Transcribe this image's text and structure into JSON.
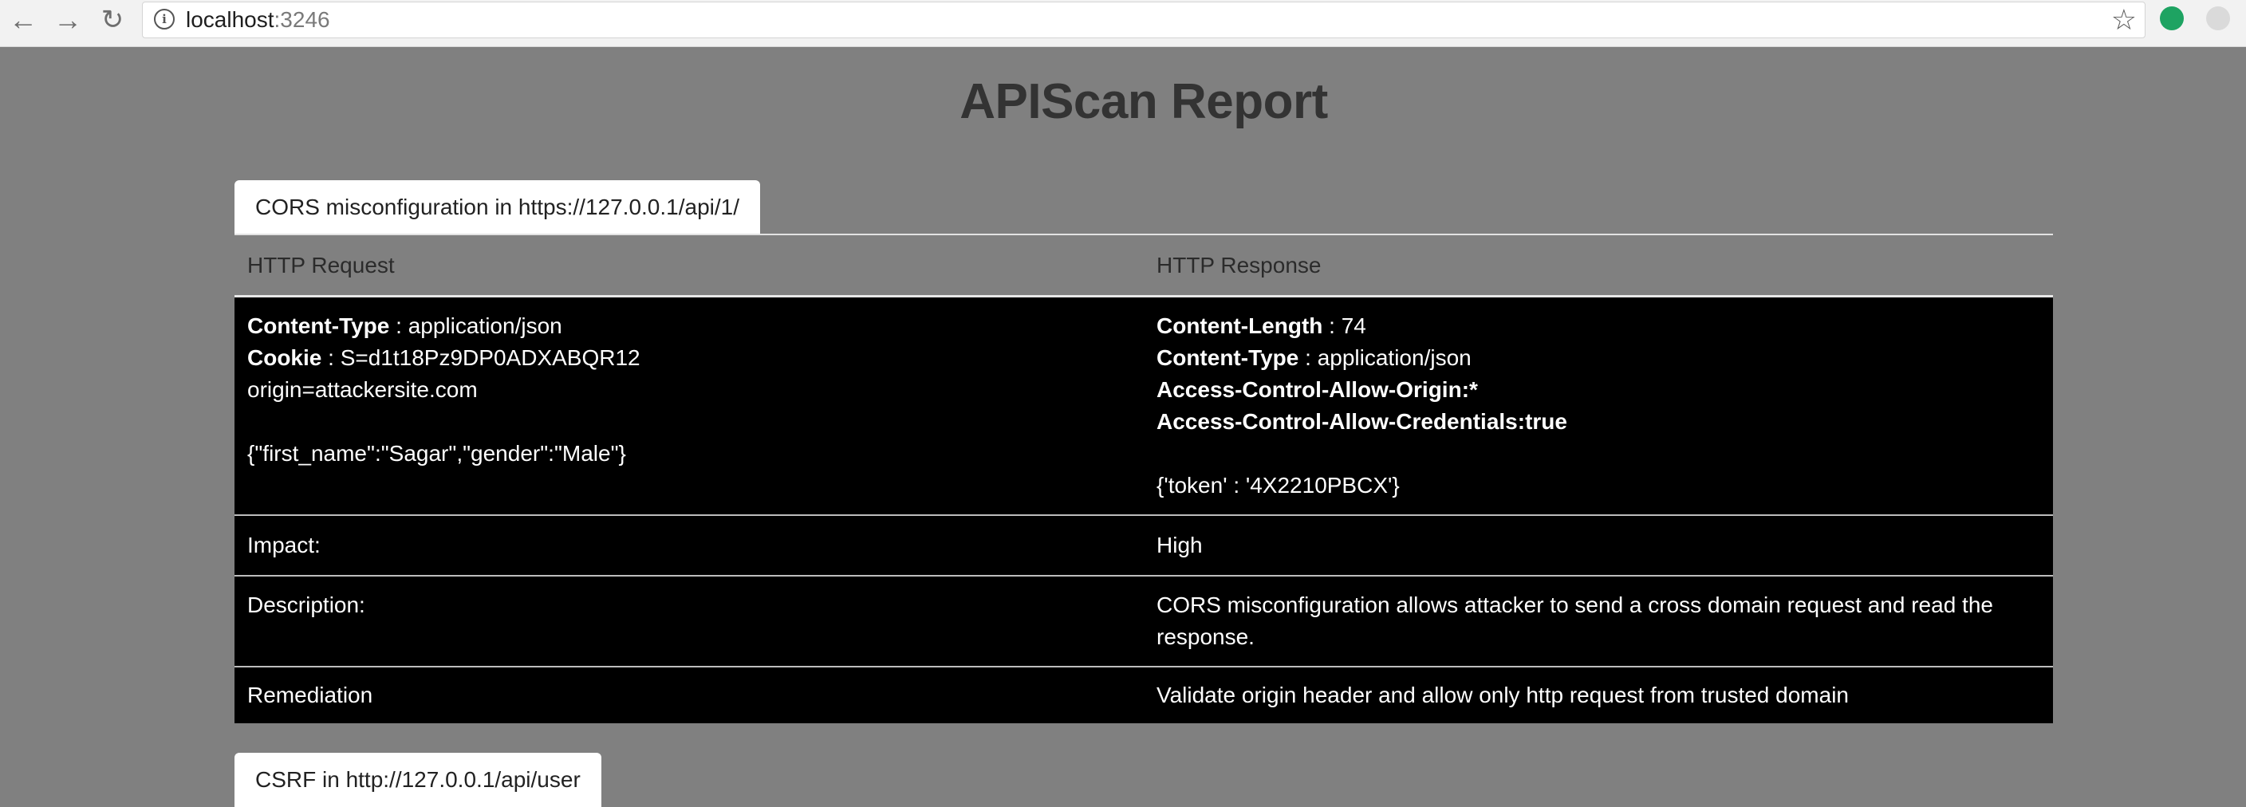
{
  "browser": {
    "url_host": "localhost",
    "url_port": ":3246",
    "icons": [
      "back-arrow-icon",
      "forward-arrow-icon",
      "reload-icon",
      "info-icon",
      "bookmark-star-icon"
    ],
    "extension_colors": [
      "#1ea362",
      "#dadada"
    ]
  },
  "page": {
    "title": "APIScan Report"
  },
  "vulnerabilities": [
    {
      "heading": "CORS misconfiguration in https://127.0.0.1/api/1/",
      "table_headers": {
        "request": "HTTP Request",
        "response": "HTTP Response"
      },
      "request": {
        "headers": [
          {
            "key": "Content-Type",
            "sep": " : ",
            "value": "application/json"
          },
          {
            "key": "Cookie",
            "sep": " : ",
            "value": "S=d1t18Pz9DP0ADXABQR12"
          }
        ],
        "extra_line": "origin=attackersite.com",
        "body": "{\"first_name\":\"Sagar\",\"gender\":\"Male\"}"
      },
      "response": {
        "headers": [
          {
            "key": "Content-Length",
            "sep": " : ",
            "value": "74"
          },
          {
            "key": "Content-Type",
            "sep": " : ",
            "value": "application/json"
          }
        ],
        "bold_lines": [
          "Access-Control-Allow-Origin:*",
          "Access-Control-Allow-Credentials:true"
        ],
        "body": "{'token' : '4X2210PBCX'}"
      },
      "impact_label": "Impact:",
      "impact_value": "High",
      "description_label": "Description:",
      "description_value": "CORS misconfiguration allows attacker to send a cross domain request and read the response.",
      "remediation_label": "Remediation",
      "remediation_value": "Validate origin header and allow only http request from trusted domain"
    },
    {
      "heading": "CSRF in http://127.0.0.1/api/user"
    }
  ]
}
